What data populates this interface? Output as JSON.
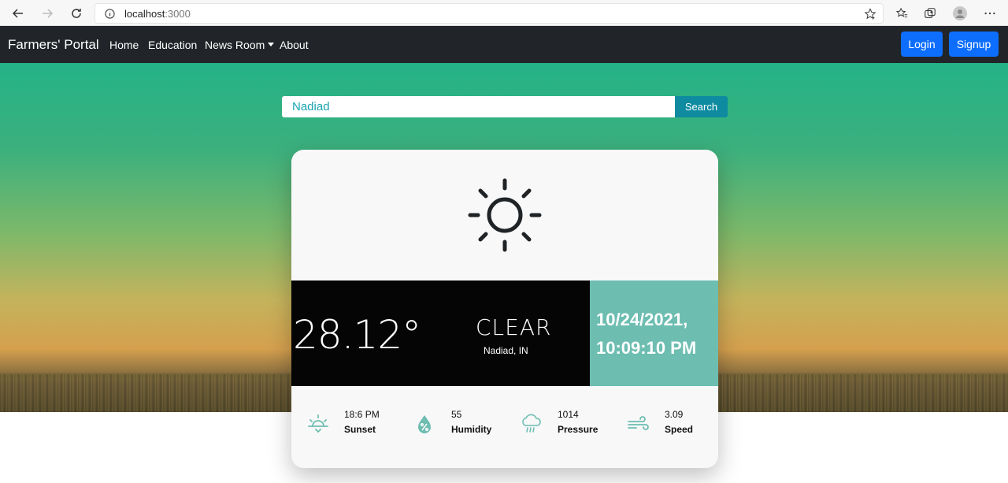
{
  "browser": {
    "url_host": "localhost",
    "url_port": ":3000"
  },
  "navbar": {
    "brand": "Farmers' Portal",
    "links": [
      "Home",
      "Education",
      "News Room",
      "About"
    ],
    "login_label": "Login",
    "signup_label": "Signup"
  },
  "search": {
    "value": "Nadiad",
    "button_label": "Search"
  },
  "weather": {
    "icon": "sun-icon",
    "temperature": "28.12°",
    "condition": "CLEAR",
    "location": "Nadiad, IN",
    "date": "10/24/2021,",
    "time": "10:09:10 PM",
    "stats": [
      {
        "icon": "sunset-icon",
        "value": "18:6 PM",
        "label": "Sunset"
      },
      {
        "icon": "humidity-icon",
        "value": "55",
        "label": "Humidity"
      },
      {
        "icon": "pressure-icon",
        "value": "1014",
        "label": "Pressure"
      },
      {
        "icon": "wind-icon",
        "value": "3.09",
        "label": "Speed"
      }
    ]
  },
  "colors": {
    "navbar_bg": "#212529",
    "primary_button": "#0d6efd",
    "search_button": "#0e8ba0",
    "date_panel": "#6dbdb1",
    "stat_icon": "#6dbdb1"
  }
}
